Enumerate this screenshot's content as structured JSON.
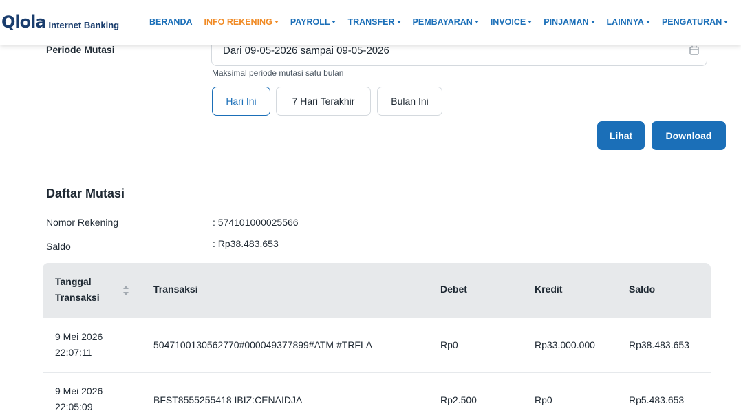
{
  "brand": {
    "logo_mark": "Qlola",
    "logo_text": "Internet Banking",
    "accent_color": "#f08a24",
    "primary_color": "#1b6fb8"
  },
  "nav": [
    {
      "label": "BERANDA",
      "dropdown": false,
      "active": false
    },
    {
      "label": "INFO REKENING",
      "dropdown": true,
      "active": true
    },
    {
      "label": "PAYROLL",
      "dropdown": true,
      "active": false
    },
    {
      "label": "TRANSFER",
      "dropdown": true,
      "active": false
    },
    {
      "label": "PEMBAYARAN",
      "dropdown": true,
      "active": false
    },
    {
      "label": "INVOICE",
      "dropdown": true,
      "active": false
    },
    {
      "label": "PINJAMAN",
      "dropdown": true,
      "active": false
    },
    {
      "label": "LAINNYA",
      "dropdown": true,
      "active": false
    },
    {
      "label": "PENGATURAN",
      "dropdown": true,
      "active": false
    }
  ],
  "filter": {
    "period_label": "Periode Mutasi",
    "period_value": "Dari 09-05-2026 sampai 09-05-2026",
    "calendar_icon": "calendar-icon",
    "hint": "Maksimal periode mutasi satu bulan",
    "quick_ranges": [
      {
        "label": "Hari Ini",
        "selected": true
      },
      {
        "label": "7 Hari Terakhir",
        "selected": false
      },
      {
        "label": "Bulan Ini",
        "selected": false
      }
    ],
    "view_label": "Lihat",
    "download_label": "Download"
  },
  "statement": {
    "title": "Daftar Mutasi",
    "account_label": "Nomor Rekening",
    "account_value": ": 574101000025566",
    "balance_label": "Saldo",
    "balance_value": ": Rp38.483.653"
  },
  "table": {
    "headers": {
      "date_line1": "Tanggal",
      "date_line2": "Transaksi",
      "transaction": "Transaksi",
      "debit": "Debet",
      "credit": "Kredit",
      "balance": "Saldo"
    },
    "sort_icon": "sort-icon",
    "rows": [
      {
        "date": "9 Mei 2026",
        "time": "22:07:11",
        "description": "5047100130562770#000049377899#ATM #TRFLA",
        "debit": "Rp0",
        "credit": "Rp33.000.000",
        "balance": "Rp38.483.653"
      },
      {
        "date": "9 Mei 2026",
        "time": "22:05:09",
        "description": "BFST8555255418 IBIZ:CENAIDJA",
        "debit": "Rp2.500",
        "credit": "Rp0",
        "balance": "Rp5.483.653"
      }
    ]
  }
}
